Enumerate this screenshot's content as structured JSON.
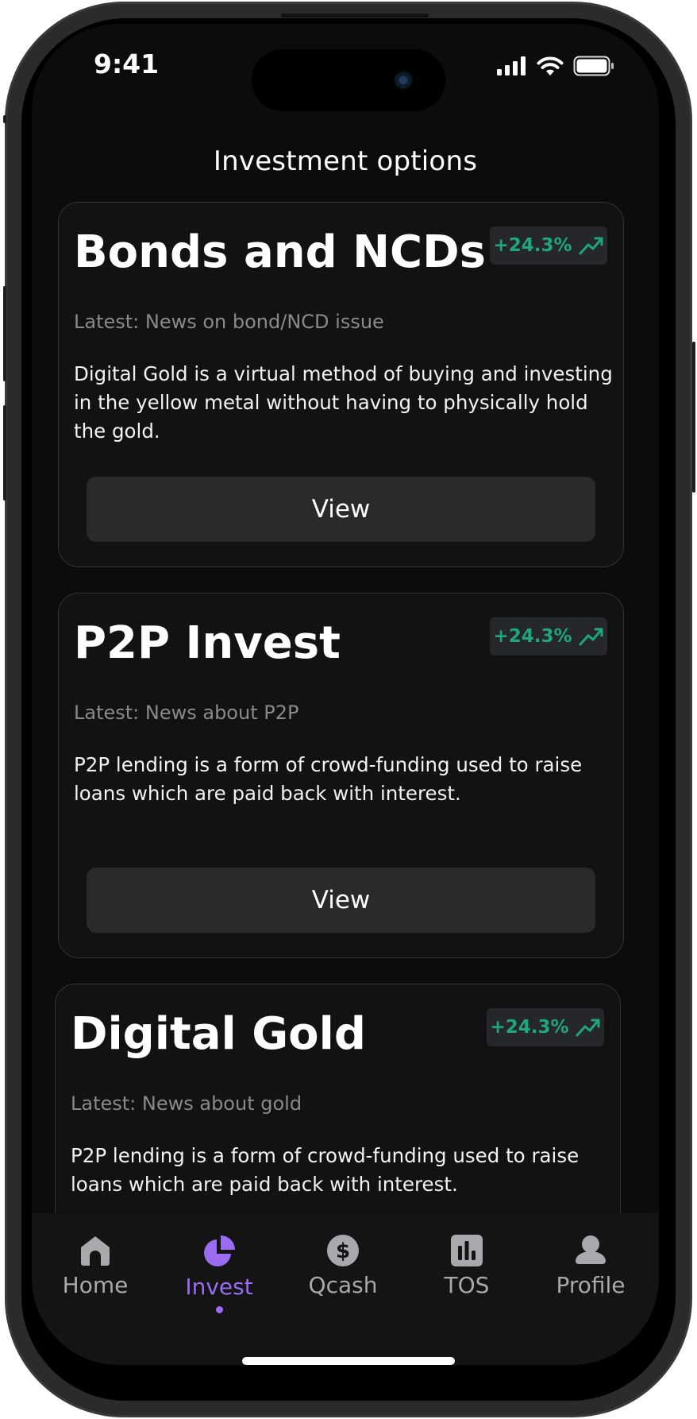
{
  "status_bar": {
    "time": "9:41"
  },
  "header": {
    "title": "Investment options"
  },
  "cards": [
    {
      "title": "Bonds and NCDs",
      "change": "+24.3%",
      "latest": "Latest: News on bond/NCD issue",
      "description": "Digital Gold is a virtual method of buying and investing in the yellow metal without having to physically hold the gold.",
      "button_label": "View"
    },
    {
      "title": "P2P Invest",
      "change": "+24.3%",
      "latest": "Latest: News about P2P",
      "description": "P2P lending is a form of crowd-funding used to raise loans which are paid back with interest.",
      "button_label": "View"
    },
    {
      "title": "Digital Gold",
      "change": "+24.3%",
      "latest": "Latest: News about gold",
      "description": "P2P lending is a form of crowd-funding used to raise loans which are paid back with interest."
    }
  ],
  "tabbar": {
    "items": [
      {
        "label": "Home",
        "icon": "home-icon"
      },
      {
        "label": "Invest",
        "icon": "pie-chart-icon",
        "active": true
      },
      {
        "label": "Qcash",
        "icon": "dollar-icon"
      },
      {
        "label": "TOS",
        "icon": "bar-chart-icon"
      },
      {
        "label": "Profile",
        "icon": "user-icon"
      }
    ]
  },
  "colors": {
    "accent": "#9b6bf2",
    "positive": "#1fa67a",
    "background": "#0c0c0d",
    "card": "#121213",
    "button": "#2a2a2b"
  }
}
